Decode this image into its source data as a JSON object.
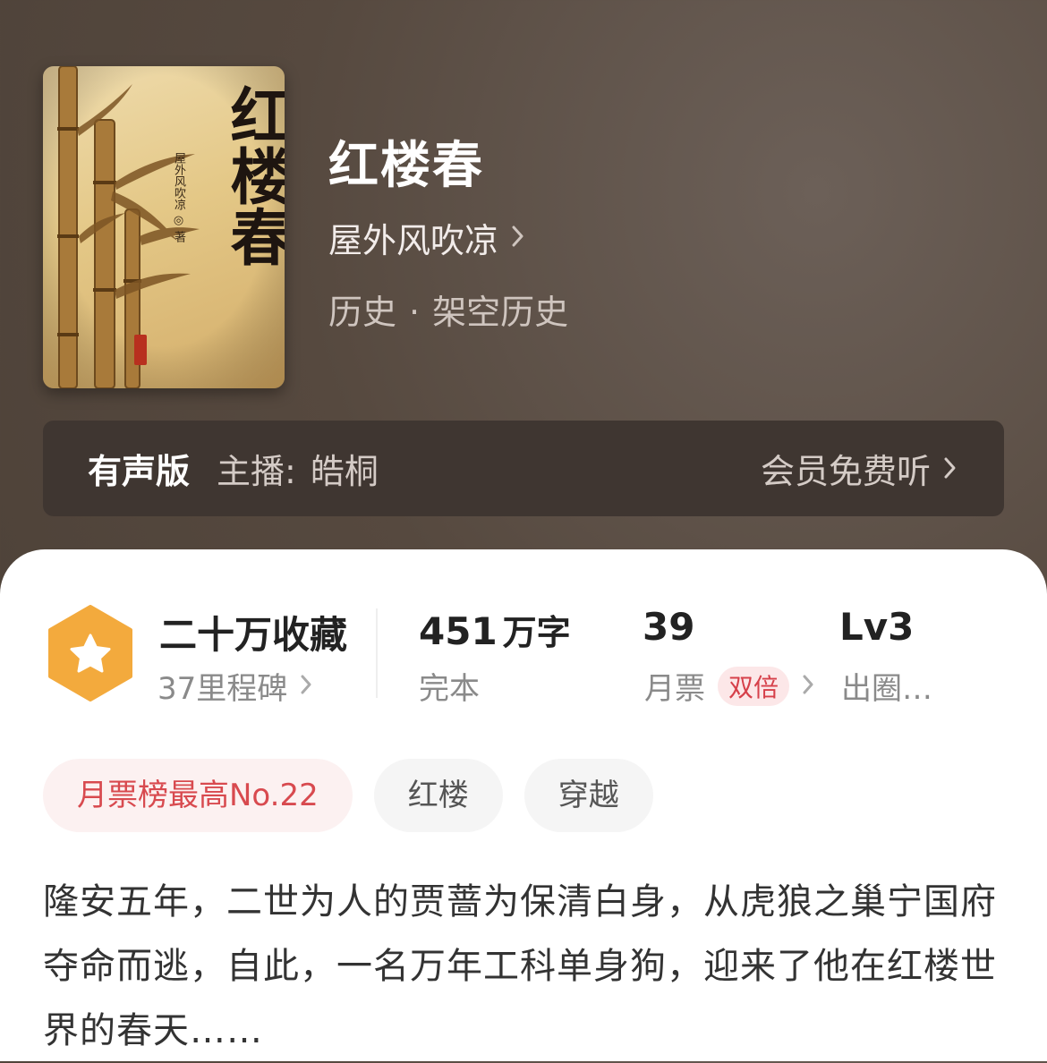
{
  "book": {
    "title": "红楼春",
    "author": "屋外风吹凉",
    "category": "历史",
    "subcategory": "架空历史",
    "category_separator": "·",
    "cover": {
      "title": "红楼春",
      "author_line": "屋外风吹凉 ◎ 著"
    }
  },
  "audio": {
    "tag": "有声版",
    "host_label": "主播:",
    "host_name": "皓桐",
    "action_label": "会员免费听"
  },
  "stats": {
    "favorites": {
      "value": "二十万收藏",
      "sub": "37里程碑"
    },
    "words": {
      "value": "451",
      "unit": "万字",
      "sub": "完本"
    },
    "monthly_ticket": {
      "value": "39",
      "sub": "月票",
      "badge": "双倍"
    },
    "level": {
      "value": "Lv3",
      "sub": "出圈…"
    }
  },
  "tags": [
    "月票榜最高No.22",
    "红楼",
    "穿越"
  ],
  "synopsis": "隆安五年，二世为人的贾蔷为保清白身，从虎狼之巢宁国府夺命而逃，自此，一名万年工科单身狗，迎来了他在红楼世界的春天……",
  "colors": {
    "header_bg": "#56493f",
    "accent_red": "#d84a4f",
    "hex_orange": "#f2a93b"
  },
  "icons": {
    "chevron": "chevron-right-icon",
    "favorites": "star-hexagon-icon"
  }
}
